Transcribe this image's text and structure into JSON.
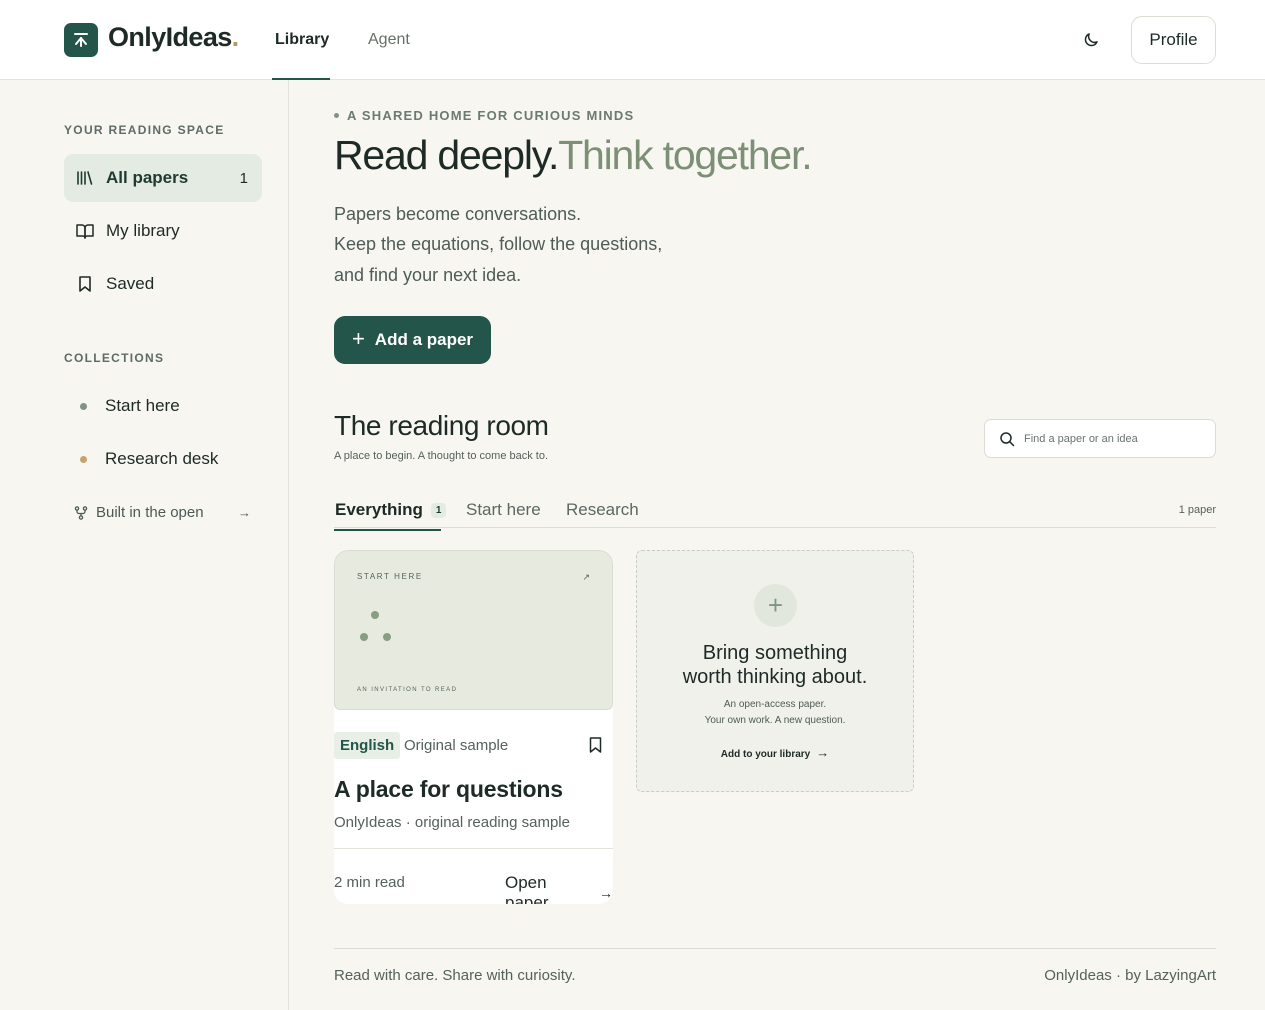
{
  "brand": {
    "name": "OnlyIdeas",
    "dot": "."
  },
  "nav": {
    "tabs": [
      {
        "label": "Library"
      },
      {
        "label": "Agent"
      }
    ],
    "profile_label": "Profile"
  },
  "sidebar": {
    "heading": "YOUR READING SPACE",
    "items": [
      {
        "label": "All papers",
        "count": "1",
        "icon": "library-icon"
      },
      {
        "label": "My library",
        "icon": "book-open-icon"
      },
      {
        "label": "Saved",
        "icon": "bookmark-icon"
      }
    ],
    "collections_heading": "COLLECTIONS",
    "collections": [
      {
        "label": "Start here",
        "color": "#7f9482"
      },
      {
        "label": "Research desk",
        "color": "#c8a26b"
      }
    ],
    "built_link": "Built in the open"
  },
  "hero": {
    "kicker": "A SHARED HOME FOR CURIOUS MINDS",
    "title_part1": "Read deeply.",
    "title_part2": "Think together.",
    "lines": [
      "Papers become conversations.",
      "Keep the equations, follow the questions,",
      "and find your next idea."
    ],
    "add_button": "Add a paper"
  },
  "reading_room": {
    "title": "The reading room",
    "subtitle": "A place to begin. A thought to come back to.",
    "search_placeholder": "Find a paper or an idea",
    "tabs": [
      {
        "label": "Everything",
        "badge": "1"
      },
      {
        "label": "Start here"
      },
      {
        "label": "Research"
      }
    ],
    "paper_count": "1 paper"
  },
  "card": {
    "cover_label": "START HERE",
    "cover_arrow": "↗",
    "cover_bottom": "AN INVITATION TO READ",
    "language": "English",
    "tag": "Original sample",
    "title": "A place for questions",
    "meta": "OnlyIdeas · original reading sample",
    "read_time": "2 min read",
    "open_label": "Open paper"
  },
  "add_card": {
    "title_line1": "Bring something",
    "title_line2": "worth thinking about.",
    "sub_line1": "An open-access paper.",
    "sub_line2": "Your own work. A new question.",
    "link": "Add to your library"
  },
  "footer": {
    "left": "Read with care. Share with curiosity.",
    "right": "OnlyIdeas · by LazyingArt"
  },
  "colors": {
    "accent": "#24554a",
    "accent_light": "#e4ebe2",
    "muted_green": "#7d8f76",
    "gold": "#b79a68"
  }
}
